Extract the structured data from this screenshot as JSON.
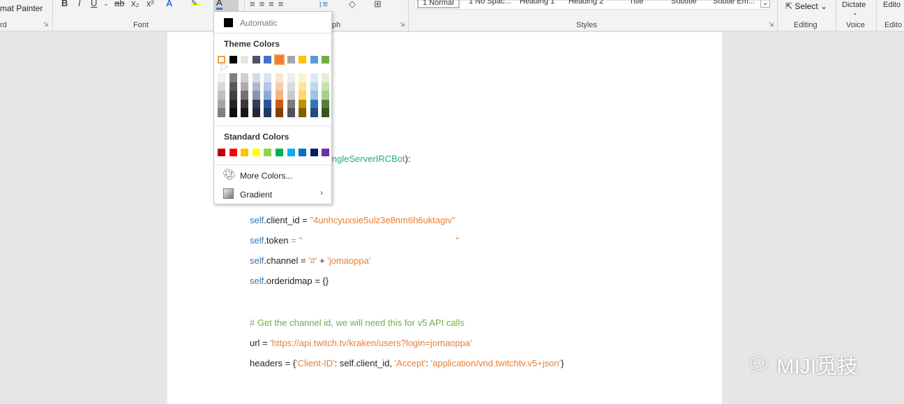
{
  "ribbon": {
    "clipboard": {
      "format_painter": "mat Painter",
      "group": "rd"
    },
    "font": {
      "group": "Font",
      "bold": "B",
      "italic": "I",
      "underline": "U",
      "strike": "ab",
      "sub": "x₂",
      "sup": "x²",
      "font_color": "A"
    },
    "paragraph": {
      "group": "ph"
    },
    "styles": {
      "group": "Styles",
      "items": [
        "1 Normal",
        "1 No Spac...",
        "Heading 1",
        "Heading 2",
        "Title",
        "Subtitle",
        "Subtle Em..."
      ]
    },
    "editing": {
      "group": "Editing",
      "select": "Select"
    },
    "voice": {
      "group": "Voice",
      "dictate": "Dictate"
    },
    "editor": {
      "group": "Edito",
      "label": "Edito"
    }
  },
  "color_menu": {
    "automatic": "Automatic",
    "theme_title": "Theme Colors",
    "theme_colors": [
      "#ffffff",
      "#000000",
      "#e7e6e6",
      "#44546a",
      "#4472c4",
      "#ed7d31",
      "#a5a5a5",
      "#ffc000",
      "#5b9bd5",
      "#70ad47"
    ],
    "theme_shades": [
      [
        "#f2f2f2",
        "#d9d9d9",
        "#bfbfbf",
        "#a6a6a6",
        "#808080"
      ],
      [
        "#808080",
        "#595959",
        "#404040",
        "#262626",
        "#0d0d0d"
      ],
      [
        "#d0cece",
        "#aeabab",
        "#757171",
        "#3a3838",
        "#171616"
      ],
      [
        "#d6dce4",
        "#adb9ca",
        "#8497b0",
        "#333f4f",
        "#222a35"
      ],
      [
        "#d9e2f3",
        "#b4c6e7",
        "#8eaadb",
        "#2f5496",
        "#1f3864"
      ],
      [
        "#fbe5d5",
        "#f7cbac",
        "#f4b183",
        "#c55a11",
        "#833c0b"
      ],
      [
        "#ededed",
        "#dbdbdb",
        "#c9c9c9",
        "#7b7b7b",
        "#525252"
      ],
      [
        "#fff2cc",
        "#fee599",
        "#ffd965",
        "#bf9000",
        "#7f6000"
      ],
      [
        "#deebf6",
        "#bdd7ee",
        "#9dc3e6",
        "#2e75b5",
        "#1f4e79"
      ],
      [
        "#e2efd9",
        "#c5e0b3",
        "#a8d08d",
        "#538135",
        "#375623"
      ]
    ],
    "standard_title": "Standard Colors",
    "standard_colors": [
      "#c00000",
      "#ff0000",
      "#ffc000",
      "#ffff00",
      "#92d050",
      "#00b050",
      "#00b0f0",
      "#0070c0",
      "#002060",
      "#7030a0"
    ],
    "more_colors": "More Colors...",
    "gradient": "Gradient"
  },
  "code_lines": [
    [
      {
        "t": "ingleServerIRCBot",
        "c": "#1fb070"
      },
      {
        "t": "):",
        "c": "#222"
      }
    ],
    [
      {
        "t": "self",
        "c": "#2e75b6"
      },
      {
        "t": ".client_id = ",
        "c": "#222"
      },
      {
        "t": "\"4unhcyuxsie5ulz3e8nm6h6uktagiv\"",
        "c": "#ed7d31"
      }
    ],
    [
      {
        "t": "self",
        "c": "#2e75b6"
      },
      {
        "t": ".token ",
        "c": "#222"
      },
      {
        "t": "= \"                                                             \"",
        "c": "#ed7d31"
      }
    ],
    [
      {
        "t": "self",
        "c": "#2e75b6"
      },
      {
        "t": ".channel = ",
        "c": "#222"
      },
      {
        "t": "'#'",
        "c": "#ed7d31"
      },
      {
        "t": " + ",
        "c": "#222"
      },
      {
        "t": "'jomaoppa'",
        "c": "#ed7d31"
      }
    ],
    [
      {
        "t": "self",
        "c": "#2e75b6"
      },
      {
        "t": ".orderidmap = {}",
        "c": "#222"
      }
    ],
    [
      {
        "t": "# Get the channel id, we will need this for v5 API calls",
        "c": "#70ad47"
      }
    ],
    [
      {
        "t": "url = ",
        "c": "#222"
      },
      {
        "t": "'https://api.twitch.tv/kraken/users?login=jomaoppa'",
        "c": "#ed7d31"
      }
    ],
    [
      {
        "t": "headers = {",
        "c": "#222"
      },
      {
        "t": "'Client-ID'",
        "c": "#ed7d31"
      },
      {
        "t": ": self.client_id, ",
        "c": "#222"
      },
      {
        "t": "'Accept'",
        "c": "#ed7d31"
      },
      {
        "t": ": ",
        "c": "#222"
      },
      {
        "t": "'application/vnd.twitchtv.v5+json'",
        "c": "#ed7d31"
      },
      {
        "t": "}",
        "c": "#222"
      }
    ]
  ],
  "watermark": "MIJI觅技"
}
